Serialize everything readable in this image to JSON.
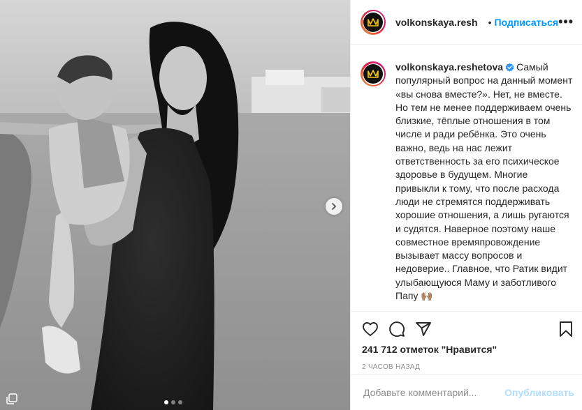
{
  "post": {
    "username": "volkonskaya.reshetova",
    "header_username": "volkonskaya.resh",
    "separator": "•",
    "follow_label": "Подписаться",
    "more_label": "•••",
    "caption": "Самый популярный вопрос на данный момент «вы снова вместе?». Нет, не вместе. Но тем не менее поддерживаем очень близкие, тёплые отношения в том числе и ради ребёнка. Это очень важно, ведь на нас лежит ответственность за его психическое здоровье в будущем. Многие привыкли к тому, что после расхода люди не стремятся поддерживать хорошие отношения, а лишь ругаются и судятся. Наверное поэтому наше совместное времяпровождение вызывает массу вопросов и недоверие.. Главное, что Ратик видит улыбающуюся Маму и заботливого Папу 🙌🏽",
    "likes": "241 712 отметок \"Нравится\"",
    "time": "2 часов назад",
    "carousel_position": 1,
    "carousel_total": 3
  },
  "comment": {
    "placeholder": "Добавьте комментарий...",
    "post_label": "Опубликовать"
  },
  "colors": {
    "accent": "#0095f6",
    "post_disabled": "#b2dffc",
    "text": "#262626",
    "muted": "#8e8e8e",
    "verified": "#3897f0"
  },
  "icons": [
    "crown-logo-icon",
    "verified-badge-icon",
    "heart-icon",
    "comment-icon",
    "share-icon",
    "bookmark-icon",
    "chevron-right-icon",
    "multiple-photos-icon"
  ]
}
